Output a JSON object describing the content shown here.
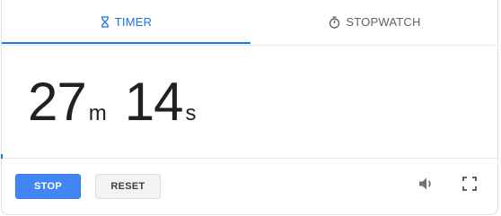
{
  "tabs": [
    {
      "label": "TIMER",
      "icon": "hourglass-icon",
      "active": true
    },
    {
      "label": "STOPWATCH",
      "icon": "stopwatch-icon",
      "active": false
    }
  ],
  "display": {
    "minutes": "27",
    "minutes_unit": "m",
    "seconds": "14",
    "seconds_unit": "s"
  },
  "controls": {
    "stop_label": "STOP",
    "reset_label": "RESET",
    "volume_icon": "volume-icon",
    "fullscreen_icon": "fullscreen-icon"
  },
  "colors": {
    "accent": "#1a73e8",
    "stop_button": "#4285f4",
    "text": "#202124",
    "muted": "#5f6368"
  }
}
